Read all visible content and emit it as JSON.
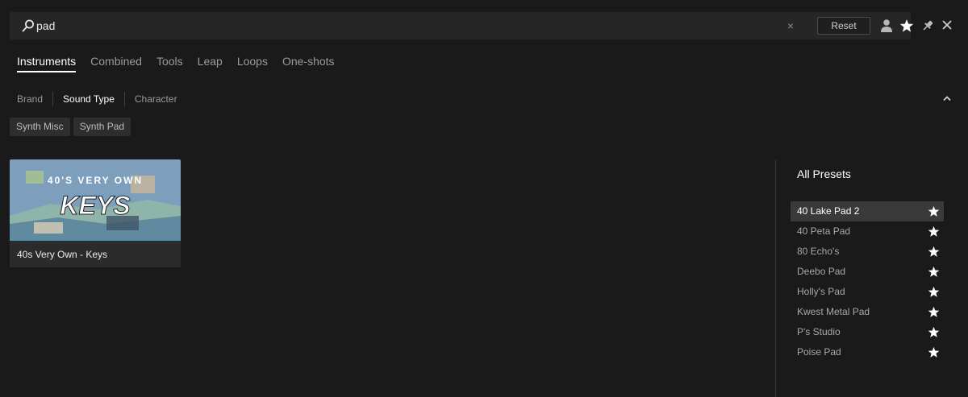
{
  "search": {
    "value": "pad",
    "clear_label": "×",
    "reset_label": "Reset"
  },
  "tabs": [
    {
      "label": "Instruments",
      "active": true
    },
    {
      "label": "Combined"
    },
    {
      "label": "Tools"
    },
    {
      "label": "Leap"
    },
    {
      "label": "Loops"
    },
    {
      "label": "One-shots"
    }
  ],
  "filters": [
    {
      "label": "Brand"
    },
    {
      "label": "Sound Type",
      "active": true
    },
    {
      "label": "Character"
    }
  ],
  "chips": [
    "Synth Misc",
    "Synth Pad"
  ],
  "card": {
    "title": "40s Very Own - Keys",
    "art_text": "40'S VERY OWN",
    "art_logo": "KEYS"
  },
  "presets": {
    "title": "All Presets",
    "items": [
      {
        "label": "40 Lake Pad 2",
        "selected": true
      },
      {
        "label": "40 Peta Pad"
      },
      {
        "label": "80 Echo's"
      },
      {
        "label": "Deebo Pad"
      },
      {
        "label": "Holly's Pad"
      },
      {
        "label": "Kwest Metal Pad"
      },
      {
        "label": "P's Studio"
      },
      {
        "label": "Poise Pad"
      }
    ]
  },
  "icons": {
    "search": "search-icon",
    "clear": "clear-icon",
    "user": "user-icon",
    "favorites": "star-icon",
    "pin": "pin-icon",
    "close": "close-icon",
    "collapse": "chevron-up-icon",
    "preset_star": "star-icon"
  },
  "colors": {
    "background": "#1a1a1a",
    "panel": "#262626",
    "selected_row": "#3a3a3a",
    "text_active": "#ffffff",
    "text_muted": "#9a9a9a"
  }
}
